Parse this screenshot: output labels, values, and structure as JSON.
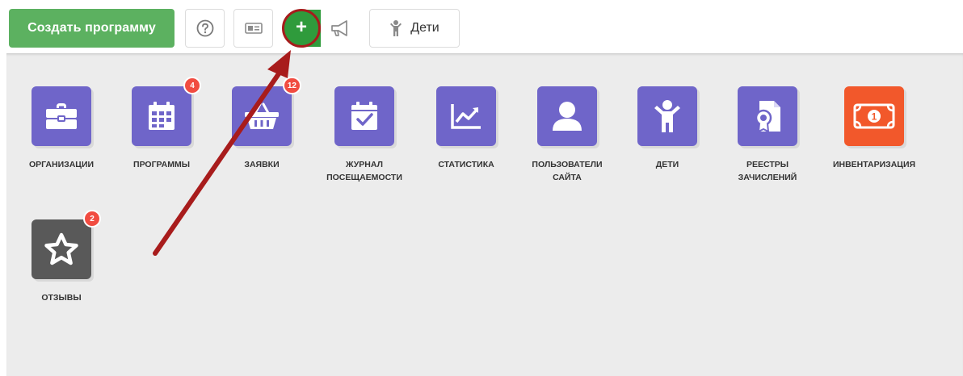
{
  "toolbar": {
    "create_program_label": "Создать программу",
    "kids_label": "Дети",
    "plus_symbol": "+"
  },
  "tiles": [
    {
      "label": "ОРГАНИЗАЦИИ",
      "icon": "briefcase-icon",
      "badge": ""
    },
    {
      "label": "ПРОГРАММЫ",
      "icon": "calendar-icon",
      "badge": "4"
    },
    {
      "label": "ЗАЯВКИ",
      "icon": "basket-icon",
      "badge": "12"
    },
    {
      "label": "ЖУРНАЛ ПОСЕЩАЕМОСТИ",
      "icon": "calendar-check-icon",
      "badge": ""
    },
    {
      "label": "СТАТИСТИКА",
      "icon": "chart-icon",
      "badge": ""
    },
    {
      "label": "ПОЛЬЗОВАТЕЛИ САЙТА",
      "icon": "user-icon",
      "badge": ""
    },
    {
      "label": "ДЕТИ",
      "icon": "child-icon",
      "badge": ""
    },
    {
      "label": "РЕЕСТРЫ ЗАЧИСЛЕНИЙ",
      "icon": "certificate-icon",
      "badge": ""
    },
    {
      "label": "ИНВЕНТАРИЗАЦИЯ",
      "icon": "banknote-icon",
      "badge": ""
    },
    {
      "label": "ОТЗЫВЫ",
      "icon": "star-icon",
      "badge": "2"
    }
  ],
  "colors": {
    "primary_green": "#5cb160",
    "plus_green": "#2f9b3c",
    "tile_violet": "#6f65c9",
    "tile_orange": "#f2582b",
    "tile_gray": "#595959",
    "badge_red": "#f14c41",
    "annotation_red": "#a61c1c",
    "dashboard_bg": "#ececec"
  }
}
